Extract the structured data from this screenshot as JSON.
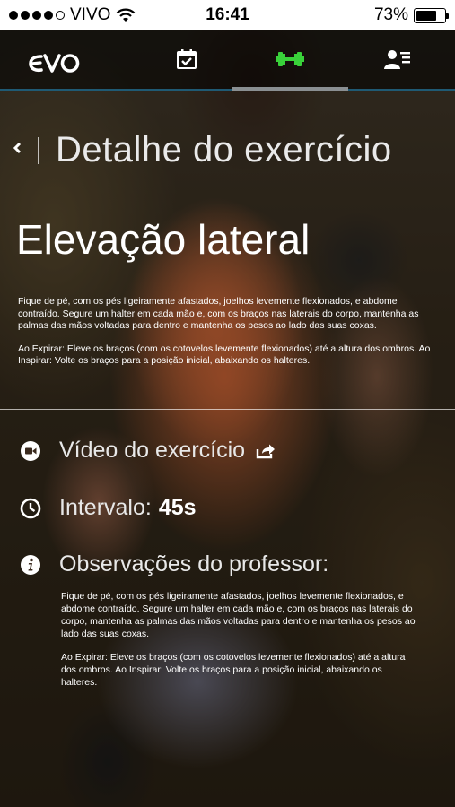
{
  "status_bar": {
    "carrier": "VIVO",
    "time": "16:41",
    "battery": "73%",
    "battery_level": 0.73,
    "signal_bars_filled": 4,
    "signal_bars_total": 5
  },
  "nav": {
    "logo": "evo",
    "tabs": [
      {
        "icon": "calendar-check-icon"
      },
      {
        "icon": "dumbbell-icon",
        "active": true,
        "color": "#39d13a"
      },
      {
        "icon": "user-list-icon"
      }
    ]
  },
  "header": {
    "title": "Detalhe do exercício"
  },
  "exercise": {
    "name": "Elevação lateral",
    "description": [
      "Fique de pé, com os pés ligeiramente afastados, joelhos levemente flexionados, e abdome contraído. Segure um halter em cada mão e, com os braços nas laterais do corpo, mantenha as palmas das mãos voltadas para dentro e mantenha os pesos ao lado das suas coxas.",
      "Ao Expirar: Eleve os braços (com os cotovelos levemente flexionados) até a altura dos ombros. Ao Inspirar: Volte os braços para a posição inicial, abaixando os halteres."
    ]
  },
  "details": {
    "video_label": "Vídeo do exercício",
    "interval_label": "Intervalo:",
    "interval_value": "45s",
    "observations_label": "Observações do professor:",
    "observations": [
      "Fique de pé, com os pés ligeiramente afastados, joelhos levemente flexionados, e abdome contraído. Segure um halter em cada mão e, com os braços nas laterais do corpo, mantenha as palmas das mãos voltadas para dentro e mantenha os pesos ao lado das suas coxas.",
      "Ao Expirar: Eleve os braços (com os cotovelos levemente flexionados) até a altura dos ombros. Ao Inspirar: Volte os braços para a posição inicial, abaixando os halteres."
    ]
  },
  "colors": {
    "accent_green": "#39d13a",
    "nav_underline": "#1f5a74"
  }
}
